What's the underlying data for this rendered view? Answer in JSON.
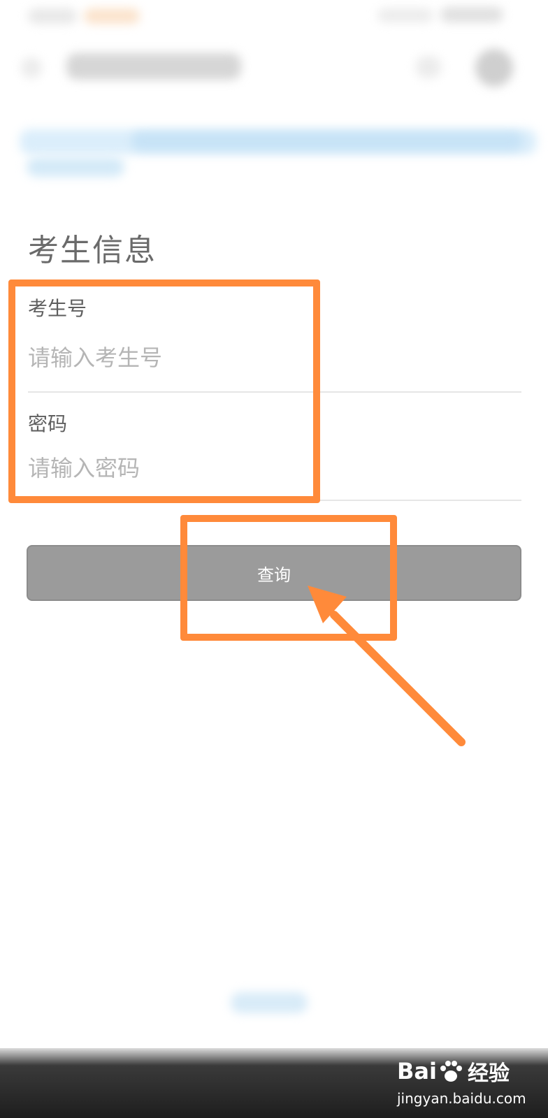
{
  "form": {
    "section_title": "考生信息",
    "exam_id": {
      "label": "考生号",
      "placeholder": "请输入考生号",
      "value": ""
    },
    "password": {
      "label": "密码",
      "placeholder": "请输入密码",
      "value": ""
    },
    "query_label": "查询"
  },
  "watermark": {
    "brand_left": "Bai",
    "brand_right": "经验",
    "url": "jingyan.baidu.com"
  },
  "colors": {
    "annotation": "#ff8a3a",
    "button_bg": "#9b9b9b",
    "banner_blue": "#dbeefb"
  },
  "icons": {
    "back": "back-arrow-icon",
    "star": "star-icon",
    "more": "more-icon",
    "watermark_paw": "paw-icon"
  }
}
